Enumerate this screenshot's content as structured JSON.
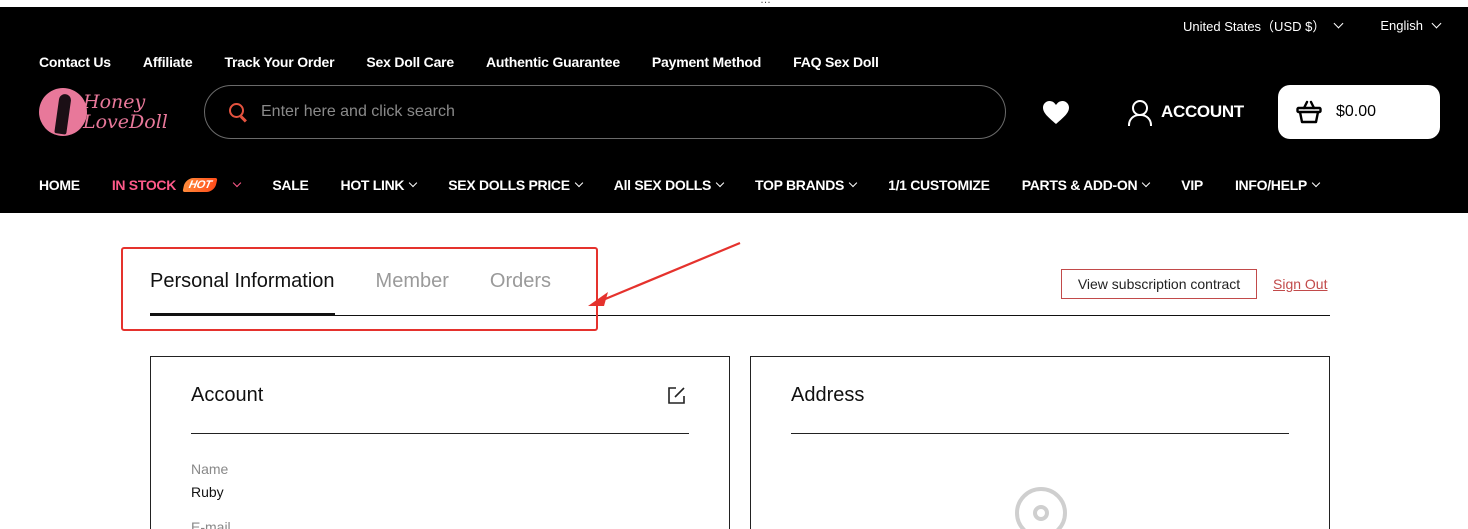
{
  "top_strip": {
    "cut_text": "…"
  },
  "utility": {
    "currency": "United States（USD $）",
    "language": "English"
  },
  "quick_links": [
    "Contact Us",
    "Affiliate",
    "Track Your Order",
    "Sex Doll Care",
    "Authentic Guarantee",
    "Payment Method",
    "FAQ Sex Doll"
  ],
  "logo": {
    "line1": "Honey",
    "line2": "LoveDoll"
  },
  "search": {
    "placeholder": "Enter here and click search"
  },
  "account": {
    "label": "ACCOUNT"
  },
  "cart": {
    "amount": "$0.00"
  },
  "nav": {
    "home": "HOME",
    "in_stock": "IN STOCK",
    "hot_badge": "HOT",
    "sale": "SALE",
    "hot_link": "HOT LINK",
    "price": "SEX DOLLS PRICE",
    "all": "All SEX DOLLS",
    "brands": "TOP BRANDS",
    "customize": "1/1 CUSTOMIZE",
    "parts": "PARTS & ADD-ON",
    "vip": "VIP",
    "info": "INFO/HELP"
  },
  "tabs": {
    "personal": "Personal Information",
    "member": "Member",
    "orders": "Orders"
  },
  "actions": {
    "view_subscription": "View subscription contract",
    "sign_out": "Sign Out"
  },
  "account_card": {
    "title": "Account",
    "name_label": "Name",
    "name_value": "Ruby",
    "email_label": "E-mail"
  },
  "address_card": {
    "title": "Address"
  },
  "colors": {
    "header_bg": "#000000",
    "accent_red": "#e5322d",
    "in_stock_pink": "#ff5a8a",
    "logo_pink": "#e8789a"
  }
}
